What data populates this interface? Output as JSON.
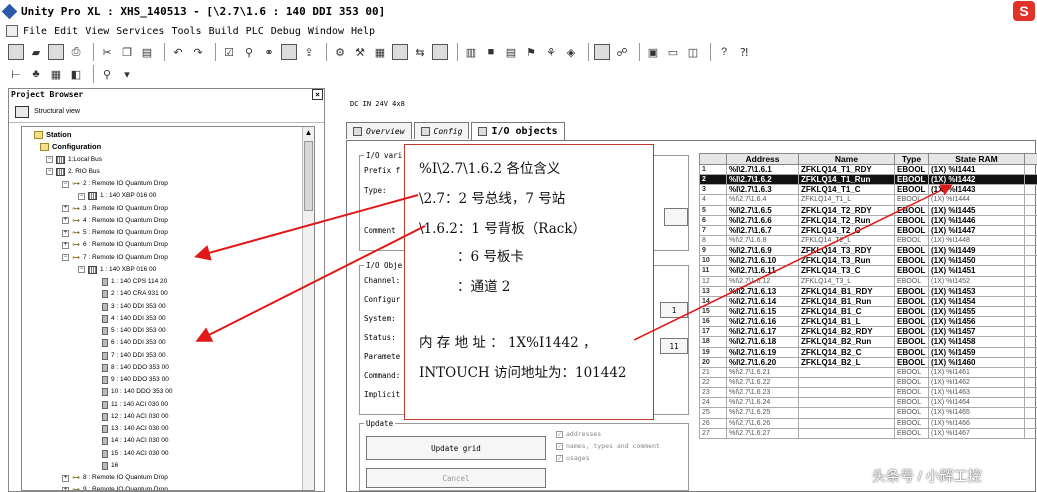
{
  "titlebar": {
    "title": "Unity Pro XL : XHS_140513 - [\\2.7\\1.6 : 140 DDI 353 00]",
    "logo": "S"
  },
  "menu": [
    "File",
    "Edit",
    "View",
    "Services",
    "Tools",
    "Build",
    "PLC",
    "Debug",
    "Window",
    "Help"
  ],
  "project_browser": {
    "title": "Project Browser",
    "close": "×",
    "structural_view": "Structural view",
    "tree": [
      {
        "label": "Station",
        "level": 0,
        "icon": "folder",
        "bold": true
      },
      {
        "label": "Configuration",
        "level": 1,
        "icon": "folder",
        "bold": true
      },
      {
        "label": "1:Local Bus",
        "level": 2,
        "icon": "rack"
      },
      {
        "label": "2. RIO Bus",
        "level": 2,
        "icon": "rack"
      },
      {
        "label": "2 : Remote IO Quantum Drop",
        "level": 3,
        "icon": "drop"
      },
      {
        "label": "1 : 140 XBP 016 00",
        "level": 4,
        "icon": "rack"
      },
      {
        "label": "3 : Remote IO Quantum Drop",
        "level": 3,
        "icon": "drop"
      },
      {
        "label": "4 : Remote IO Quantum Drop",
        "level": 3,
        "icon": "drop"
      },
      {
        "label": "5 : Remote IO Quantum Drop",
        "level": 3,
        "icon": "drop"
      },
      {
        "label": "6 : Remote IO Quantum Drop",
        "level": 3,
        "icon": "drop"
      },
      {
        "label": "7 : Remote IO Quantum Drop",
        "level": 3,
        "icon": "drop"
      },
      {
        "label": "1 : 140 XBP 016 00",
        "level": 4,
        "icon": "rack"
      },
      {
        "label": "1 : 140 CPS 114 20",
        "level": 5,
        "icon": "mod"
      },
      {
        "label": "2 : 140 CRA 931 00",
        "level": 5,
        "icon": "mod"
      },
      {
        "label": "3 : 140 DDI 353 00",
        "level": 5,
        "icon": "mod"
      },
      {
        "label": "4 : 140 DDI 353 00",
        "level": 5,
        "icon": "mod"
      },
      {
        "label": "5 : 140 DDI 353 00",
        "level": 5,
        "icon": "mod"
      },
      {
        "label": "6 : 140 DDI 353 00",
        "level": 5,
        "icon": "mod"
      },
      {
        "label": "7 : 140 DDI 353 00",
        "level": 5,
        "icon": "mod"
      },
      {
        "label": "8 : 140 DDO 353 00",
        "level": 5,
        "icon": "mod"
      },
      {
        "label": "9 : 140 DDO 353 00",
        "level": 5,
        "icon": "mod"
      },
      {
        "label": "10 : 140 DDO 353 00",
        "level": 5,
        "icon": "mod"
      },
      {
        "label": "11 : 140 ACI 030 00",
        "level": 5,
        "icon": "mod"
      },
      {
        "label": "12 : 140 ACI 030 00",
        "level": 5,
        "icon": "mod"
      },
      {
        "label": "13 : 140 ACI 030 00",
        "level": 5,
        "icon": "mod"
      },
      {
        "label": "14 : 140 ACI 030 00",
        "level": 5,
        "icon": "mod"
      },
      {
        "label": "15 : 140 ACI 030 00",
        "level": 5,
        "icon": "mod"
      },
      {
        "label": "16",
        "level": 5,
        "icon": "mod"
      },
      {
        "label": "8 : Remote IO Quantum Drop",
        "level": 3,
        "icon": "drop"
      },
      {
        "label": "9 : Remote IO Quantum Drop",
        "level": 3,
        "icon": "drop"
      }
    ]
  },
  "module_panel": {
    "description": "DC IN 24V 4x8",
    "tabs": [
      "Overview",
      "Config",
      "I/O objects"
    ],
    "active_tab": "I/O objects",
    "group_var_label": "I/O vari",
    "prefix_label": "Prefix f",
    "type_label": "Type:",
    "comment_label": "Comment",
    "group_obj_label": "I/O Obje",
    "channel_label": "Channel:",
    "config_label": "Configur",
    "system_label": "System:",
    "status_label": "Status:",
    "parameter_label": "Paramete",
    "command_label": "Command:",
    "implicit_label": "Implicit",
    "side_button_1": "1",
    "side_button_2": "11",
    "update_group_label": "Update",
    "update_grid_button": "Update grid",
    "cancel_button": "Cancel",
    "checks": [
      "addresses",
      "names, types and comment",
      "usages"
    ]
  },
  "io_table": {
    "headers": [
      "",
      "Address",
      "Name",
      "Type",
      "State RAM",
      ""
    ],
    "rows": [
      {
        "n": "1",
        "address": "%I\\2.7\\1.6.1",
        "name": "ZFKLQ14_T1_RDY",
        "type": "EBOOL",
        "ram": "(1X) %I1441",
        "style": "hi"
      },
      {
        "n": "2",
        "address": "%I\\2.7\\1.6.2",
        "name": "ZFKLQ14_T1_Run",
        "type": "EBOOL",
        "ram": "(1X) %I1442",
        "style": "sel"
      },
      {
        "n": "3",
        "address": "%I\\2.7\\1.6.3",
        "name": "ZFKLQ14_T1_C",
        "type": "EBOOL",
        "ram": "(1X) %I1443",
        "style": "hi"
      },
      {
        "n": "4",
        "address": "%I\\2.7\\1.6.4",
        "name": "ZFKLQ14_T1_L",
        "type": "EBOOL",
        "ram": "(1X) %I1444",
        "style": "dim"
      },
      {
        "n": "5",
        "address": "%I\\2.7\\1.6.5",
        "name": "ZFKLQ14_T2_RDY",
        "type": "EBOOL",
        "ram": "(1X) %I1445",
        "style": "hi"
      },
      {
        "n": "6",
        "address": "%I\\2.7\\1.6.6",
        "name": "ZFKLQ14_T2_Run",
        "type": "EBOOL",
        "ram": "(1X) %I1446",
        "style": "hi"
      },
      {
        "n": "7",
        "address": "%I\\2.7\\1.6.7",
        "name": "ZFKLQ14_T2_C",
        "type": "EBOOL",
        "ram": "(1X) %I1447",
        "style": "hi"
      },
      {
        "n": "8",
        "address": "%I\\2.7\\1.6.8",
        "name": "ZFKLQ14_T2_L",
        "type": "EBOOL",
        "ram": "(1X) %I1448",
        "style": "dim"
      },
      {
        "n": "9",
        "address": "%I\\2.7\\1.6.9",
        "name": "ZFKLQ14_T3_RDY",
        "type": "EBOOL",
        "ram": "(1X) %I1449",
        "style": "hi"
      },
      {
        "n": "10",
        "address": "%I\\2.7\\1.6.10",
        "name": "ZFKLQ14_T3_Run",
        "type": "EBOOL",
        "ram": "(1X) %I1450",
        "style": "hi"
      },
      {
        "n": "11",
        "address": "%I\\2.7\\1.6.11",
        "name": "ZFKLQ14_T3_C",
        "type": "EBOOL",
        "ram": "(1X) %I1451",
        "style": "hi"
      },
      {
        "n": "12",
        "address": "%I\\2.7\\1.6.12",
        "name": "ZFKLQ14_T3_L",
        "type": "EBOOL",
        "ram": "(1X) %I1452",
        "style": "dim"
      },
      {
        "n": "13",
        "address": "%I\\2.7\\1.6.13",
        "name": "ZFKLQ14_B1_RDY",
        "type": "EBOOL",
        "ram": "(1X) %I1453",
        "style": "hi"
      },
      {
        "n": "14",
        "address": "%I\\2.7\\1.6.14",
        "name": "ZFKLQ14_B1_Run",
        "type": "EBOOL",
        "ram": "(1X) %I1454",
        "style": "hi"
      },
      {
        "n": "15",
        "address": "%I\\2.7\\1.6.15",
        "name": "ZFKLQ14_B1_C",
        "type": "EBOOL",
        "ram": "(1X) %I1455",
        "style": "hi"
      },
      {
        "n": "16",
        "address": "%I\\2.7\\1.6.16",
        "name": "ZFKLQ14_B1_L",
        "type": "EBOOL",
        "ram": "(1X) %I1456",
        "style": "hi"
      },
      {
        "n": "17",
        "address": "%I\\2.7\\1.6.17",
        "name": "ZFKLQ14_B2_RDY",
        "type": "EBOOL",
        "ram": "(1X) %I1457",
        "style": "hi"
      },
      {
        "n": "18",
        "address": "%I\\2.7\\1.6.18",
        "name": "ZFKLQ14_B2_Run",
        "type": "EBOOL",
        "ram": "(1X) %I1458",
        "style": "hi"
      },
      {
        "n": "19",
        "address": "%I\\2.7\\1.6.19",
        "name": "ZFKLQ14_B2_C",
        "type": "EBOOL",
        "ram": "(1X) %I1459",
        "style": "hi"
      },
      {
        "n": "20",
        "address": "%I\\2.7\\1.6.20",
        "name": "ZFKLQ14_B2_L",
        "type": "EBOOL",
        "ram": "(1X) %I1460",
        "style": "hi"
      },
      {
        "n": "21",
        "address": "%I\\2.7\\1.6.21",
        "name": "",
        "type": "EBOOL",
        "ram": "(1X) %I1461",
        "style": "dim"
      },
      {
        "n": "22",
        "address": "%I\\2.7\\1.6.22",
        "name": "",
        "type": "EBOOL",
        "ram": "(1X) %I1462",
        "style": "dim"
      },
      {
        "n": "23",
        "address": "%I\\2.7\\1.6.23",
        "name": "",
        "type": "EBOOL",
        "ram": "(1X) %I1463",
        "style": "dim"
      },
      {
        "n": "24",
        "address": "%I\\2.7\\1.6.24",
        "name": "",
        "type": "EBOOL",
        "ram": "(1X) %I1464",
        "style": "dim"
      },
      {
        "n": "25",
        "address": "%I\\2.7\\1.6.25",
        "name": "",
        "type": "EBOOL",
        "ram": "(1X) %I1465",
        "style": "dim"
      },
      {
        "n": "26",
        "address": "%I\\2.7\\1.6.26",
        "name": "",
        "type": "EBOOL",
        "ram": "(1X) %I1466",
        "style": "dim"
      },
      {
        "n": "27",
        "address": "%I\\2.7\\1.6.27",
        "name": "",
        "type": "EBOOL",
        "ram": "(1X) %I1467",
        "style": "dim"
      }
    ]
  },
  "callout": {
    "line1": "%I\\2.7\\1.6.2 各位含义",
    "line2": "\\2.7：2 号总线，7 号站",
    "line3": "\\1.6.2：1 号背板（Rack）",
    "line4": "：6 号板卡",
    "line5": "：通道 2",
    "line6": "内 存 地 址 ： 1X%I1442 ，",
    "line7": "INTOUCH 访问地址为：101442"
  },
  "watermark": "头条号 / 小辉工控",
  "colors": {
    "arrow": "#e01818",
    "selected_row": "#111111"
  }
}
